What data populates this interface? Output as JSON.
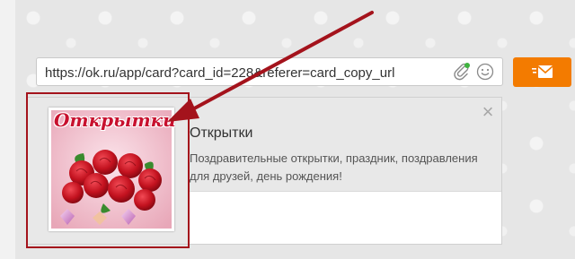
{
  "composer": {
    "url_value": "https://ok.ru/app/card?card_id=228&referer=card_copy_url",
    "attach_icon": "paperclip-icon",
    "emoji_icon": "smile-icon"
  },
  "send_button": {
    "icon": "envelope-send-icon",
    "color": "#f37b00"
  },
  "preview": {
    "close_label": "×",
    "title": "Открытки",
    "description": "Поздравительные открытки, праздник, поздравления для друзей, день рождения!",
    "thumbnail_logo": "Открытки",
    "highlight_color": "#a4131c"
  }
}
